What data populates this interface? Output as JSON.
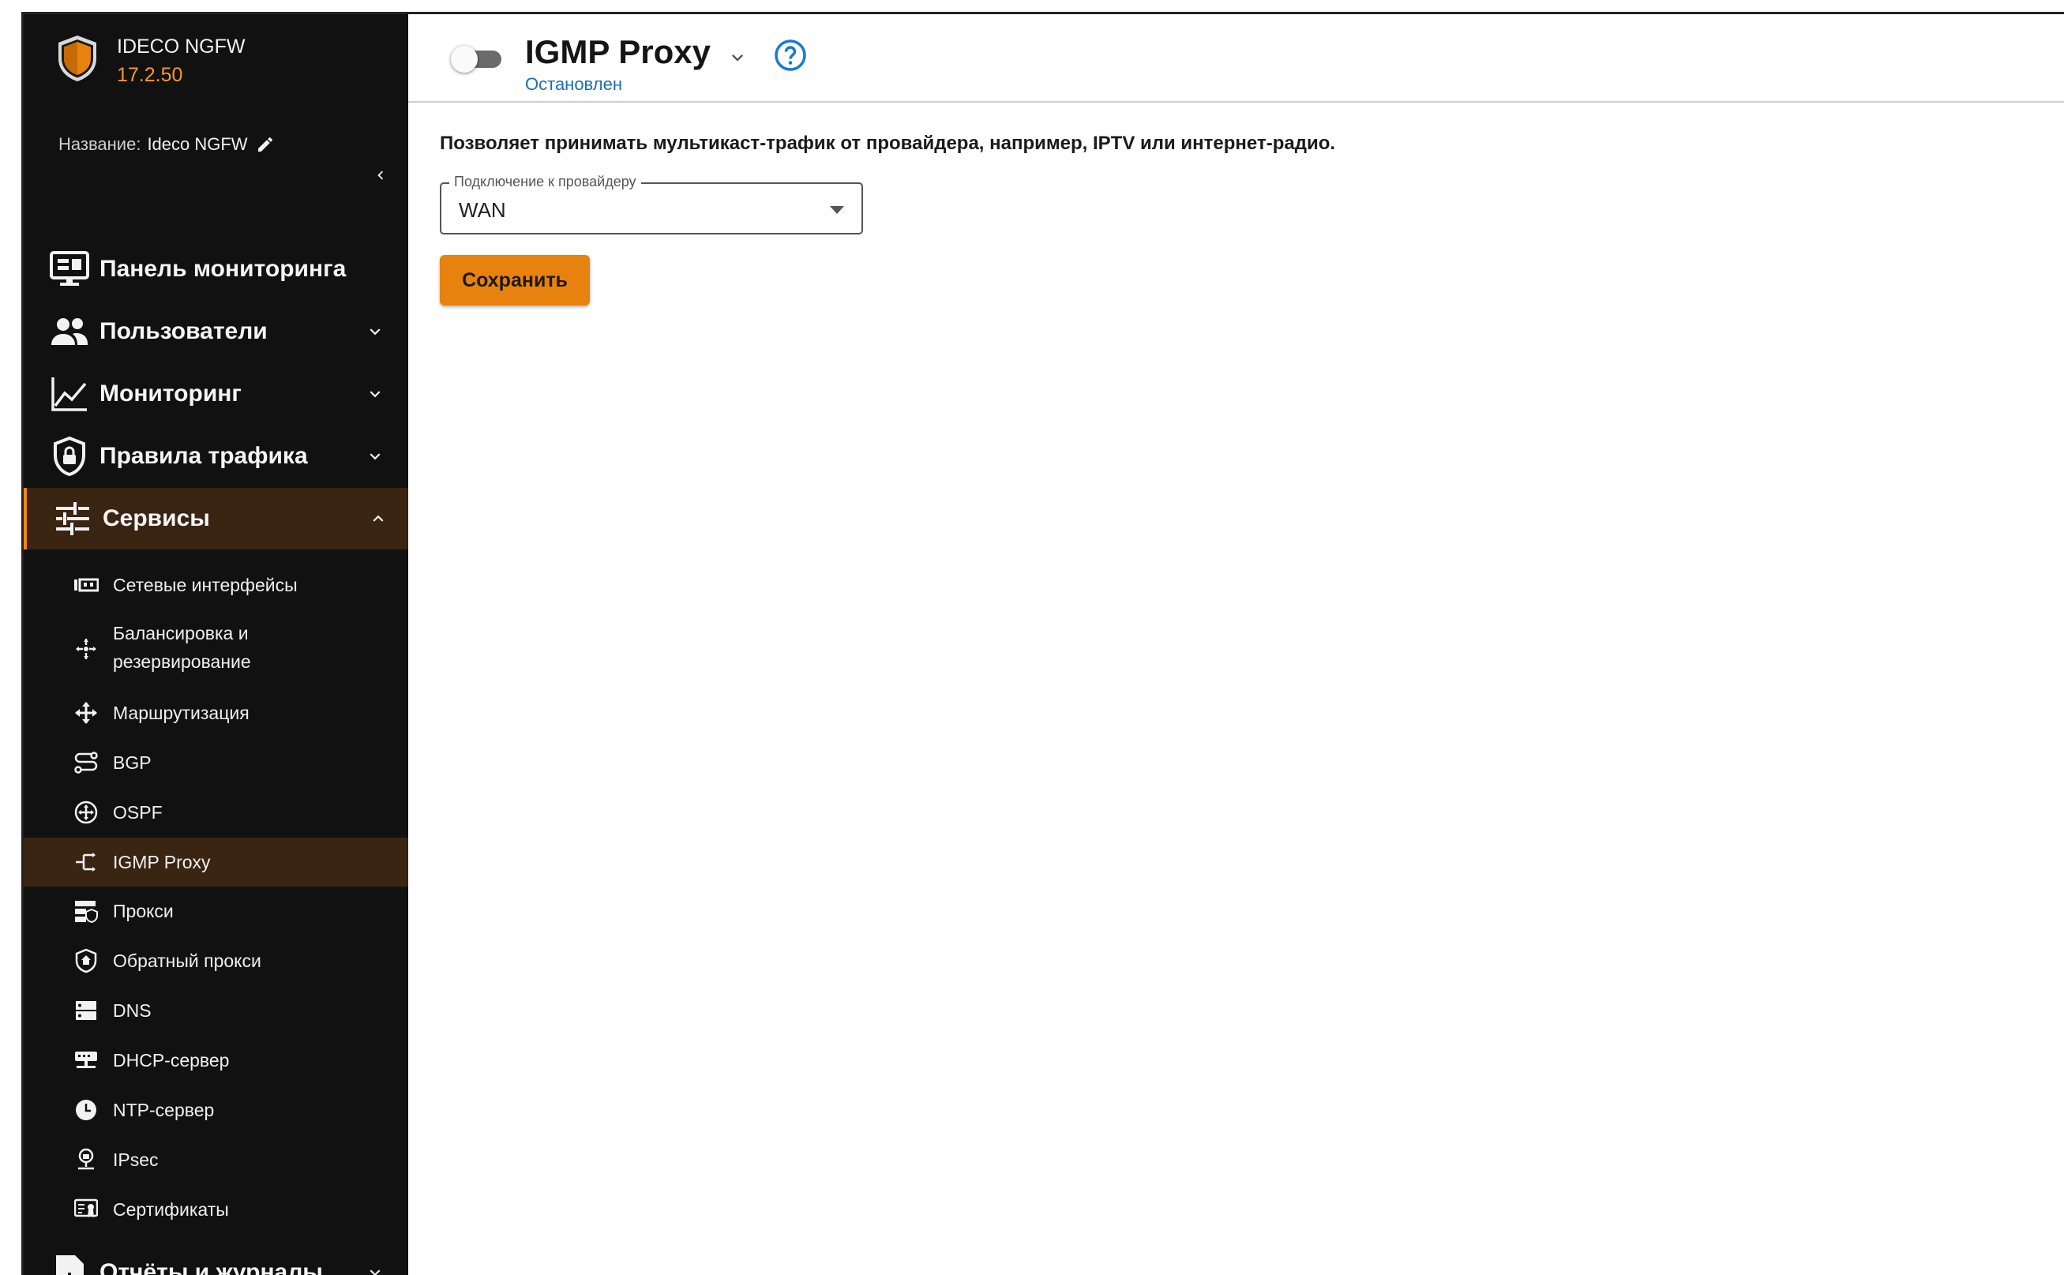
{
  "brand": {
    "name": "IDECO NGFW",
    "version": "17.2.50"
  },
  "device": {
    "label": "Название:",
    "value": "Ideco NGFW"
  },
  "colors": {
    "accent": "#e8820e",
    "sidebar_bg": "#111111",
    "active_bg": "#3a2412",
    "status_blue": "#1a6fb2"
  },
  "sidebar": {
    "main_items": [
      {
        "label": "Панель мониторинга",
        "icon": "monitor-icon"
      },
      {
        "label": "Пользователи",
        "icon": "users-icon"
      },
      {
        "label": "Мониторинг",
        "icon": "chart-line-icon"
      },
      {
        "label": "Правила трафика",
        "icon": "shield-lock-icon"
      },
      {
        "label": "Сервисы",
        "icon": "sliders-icon"
      },
      {
        "label": "Отчёты и журналы",
        "icon": "report-icon"
      }
    ],
    "services_items": [
      {
        "label": "Сетевые интерфейсы",
        "icon": "network-interface-icon"
      },
      {
        "label_line1": "Балансировка и",
        "label_line2": "резервирование",
        "icon": "balance-icon"
      },
      {
        "label": "Маршрутизация",
        "icon": "routing-icon"
      },
      {
        "label": "BGP",
        "icon": "bgp-icon"
      },
      {
        "label": "OSPF",
        "icon": "ospf-icon"
      },
      {
        "label": "IGMP Proxy",
        "icon": "igmp-icon"
      },
      {
        "label": "Прокси",
        "icon": "proxy-icon"
      },
      {
        "label": "Обратный прокси",
        "icon": "reverse-proxy-icon"
      },
      {
        "label": "DNS",
        "icon": "dns-icon"
      },
      {
        "label": "DHCP-сервер",
        "icon": "dhcp-icon"
      },
      {
        "label": "NTP-сервер",
        "icon": "clock-icon"
      },
      {
        "label": "IPsec",
        "icon": "ipsec-icon"
      },
      {
        "label": "Сертификаты",
        "icon": "certificate-icon"
      }
    ]
  },
  "header": {
    "title": "IGMP Proxy",
    "status": "Остановлен",
    "enabled": false
  },
  "main": {
    "description": "Позволяет принимать мультикаст-трафик от провайдера, например, IPTV или интернет-радио.",
    "provider_field": {
      "label": "Подключение к провайдеру",
      "value": "WAN"
    },
    "save_label": "Сохранить"
  }
}
